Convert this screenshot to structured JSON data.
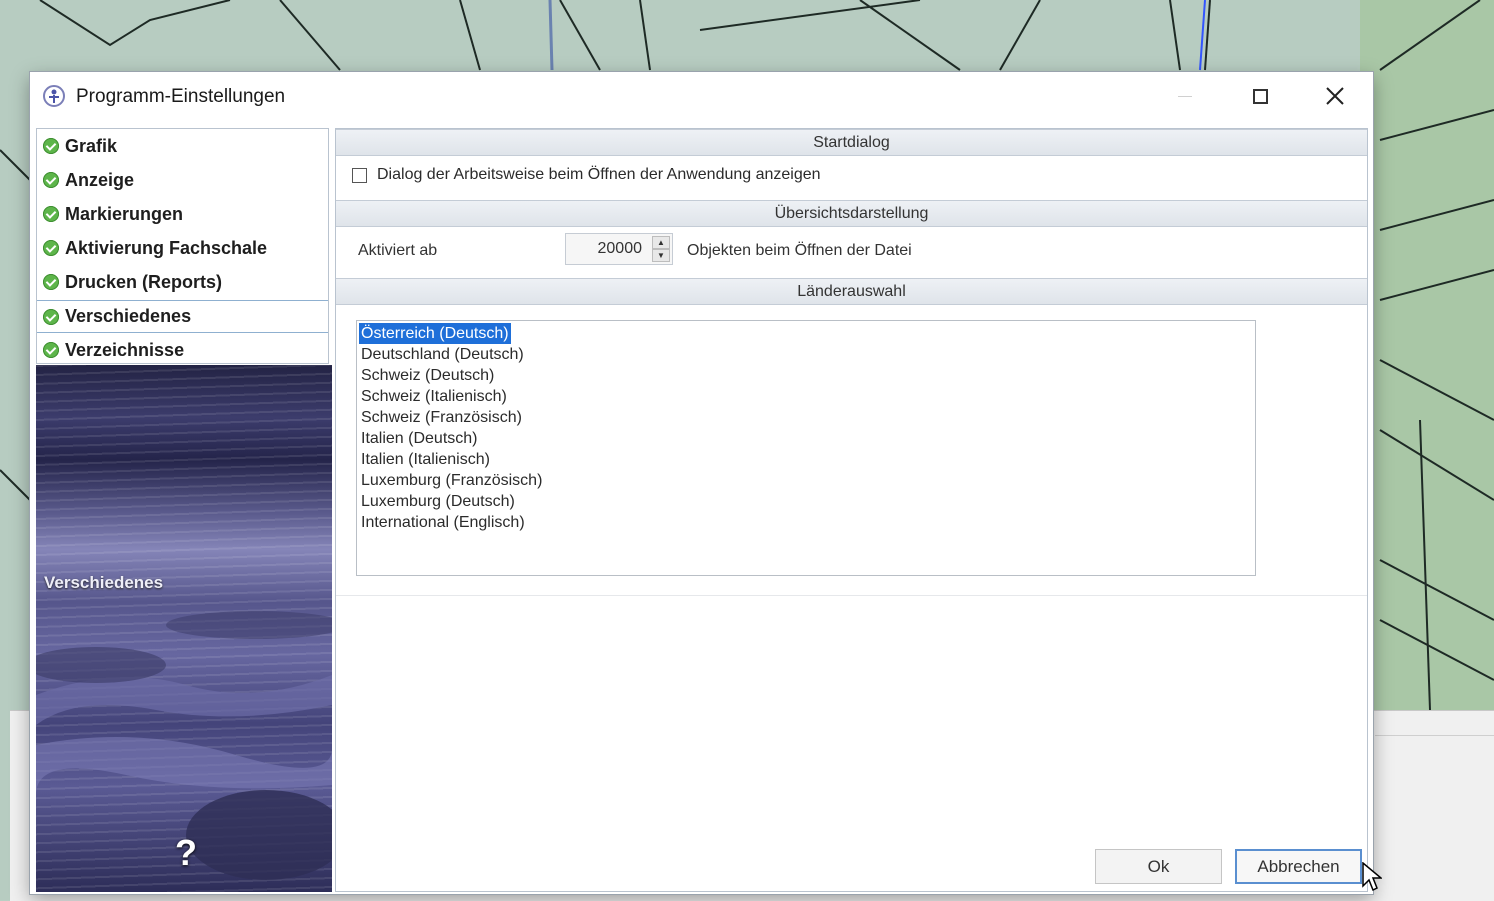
{
  "window": {
    "title": "Programm-Einstellungen"
  },
  "nav": {
    "items": [
      {
        "label": "Grafik"
      },
      {
        "label": "Anzeige"
      },
      {
        "label": "Markierungen"
      },
      {
        "label": "Aktivierung Fachschale"
      },
      {
        "label": "Drucken (Reports)"
      },
      {
        "label": "Verschiedenes",
        "selected": true
      },
      {
        "label": "Verzeichnisse"
      }
    ]
  },
  "side_panel": {
    "caption": "Verschiedenes",
    "help_symbol": "?"
  },
  "sections": {
    "startdialog": {
      "header": "Startdialog",
      "checkbox_label": "Dialog der Arbeitsweise beim Öffnen der Anwendung anzeigen",
      "checked": false
    },
    "uebersicht": {
      "header": "Übersichtsdarstellung",
      "label_before": "Aktiviert ab",
      "spin_value": "20000",
      "label_after": "Objekten beim Öffnen der Datei"
    },
    "laender": {
      "header": "Länderauswahl",
      "items": [
        "Österreich (Deutsch)",
        "Deutschland (Deutsch)",
        "Schweiz (Deutsch)",
        "Schweiz (Italienisch)",
        "Schweiz (Französisch)",
        "Italien (Deutsch)",
        "Italien (Italienisch)",
        "Luxemburg (Französisch)",
        "Luxemburg (Deutsch)",
        "International (Englisch)"
      ],
      "selected_index": 0
    }
  },
  "buttons": {
    "ok": "Ok",
    "cancel": "Abbrechen"
  },
  "colors": {
    "accent": "#1e6fd9",
    "check_green": "#5db54a",
    "map_green": "#b9cfc4"
  }
}
